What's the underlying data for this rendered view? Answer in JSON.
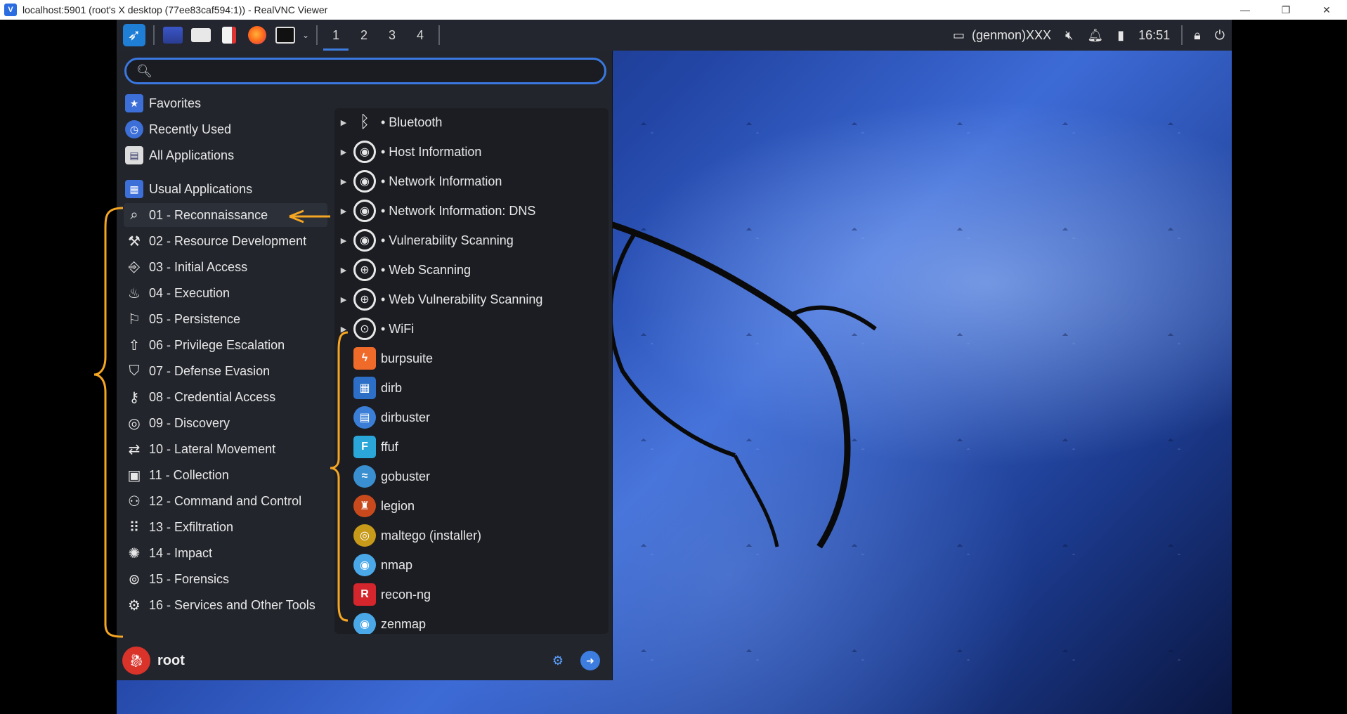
{
  "window": {
    "title": "localhost:5901 (root's X desktop (77ee83caf594:1)) - RealVNC Viewer",
    "minimize": "—",
    "maximize": "❐",
    "close": "✕"
  },
  "panel": {
    "workspaces": [
      "1",
      "2",
      "3",
      "4"
    ],
    "active_workspace": "1",
    "genmon": "(genmon)XXX",
    "clock": "16:51"
  },
  "menu": {
    "search_value": "",
    "categories": [
      {
        "label": "Favorites",
        "icon": "star-folder-icon"
      },
      {
        "label": "Recently Used",
        "icon": "clock-icon"
      },
      {
        "label": "All Applications",
        "icon": "apps-folder-icon"
      },
      {
        "label": "Usual Applications",
        "icon": "grid-icon"
      },
      {
        "label": "01 - Reconnaissance",
        "icon": "magnifier-icon"
      },
      {
        "label": "02 - Resource Development",
        "icon": "hammer-icon"
      },
      {
        "label": "03 - Initial Access",
        "icon": "door-icon"
      },
      {
        "label": "04 - Execution",
        "icon": "fire-icon"
      },
      {
        "label": "05 - Persistence",
        "icon": "runner-icon"
      },
      {
        "label": "06 - Privilege Escalation",
        "icon": "arrow-up-icon"
      },
      {
        "label": "07 - Defense Evasion",
        "icon": "shield-icon"
      },
      {
        "label": "08 - Credential Access",
        "icon": "key-icon"
      },
      {
        "label": "09 - Discovery",
        "icon": "radar-icon"
      },
      {
        "label": "10 - Lateral Movement",
        "icon": "swap-icon"
      },
      {
        "label": "11 - Collection",
        "icon": "archive-icon"
      },
      {
        "label": "12 - Command and Control",
        "icon": "gamepad-icon"
      },
      {
        "label": "13 - Exfiltration",
        "icon": "grid-dots-icon"
      },
      {
        "label": "14 - Impact",
        "icon": "blast-icon"
      },
      {
        "label": "15 - Forensics",
        "icon": "fingerprint-icon"
      },
      {
        "label": "16 - Services and Other Tools",
        "icon": "tools-icon"
      }
    ],
    "selected_category": "01 - Reconnaissance",
    "apps": [
      {
        "label": "• Bluetooth",
        "submenu": true,
        "icon": "bluetooth-icon"
      },
      {
        "label": "• Host Information",
        "submenu": true,
        "icon": "magnifier-icon"
      },
      {
        "label": "• Network Information",
        "submenu": true,
        "icon": "magnifier-icon"
      },
      {
        "label": "• Network Information: DNS",
        "submenu": true,
        "icon": "magnifier-icon"
      },
      {
        "label": "• Vulnerability Scanning",
        "submenu": true,
        "icon": "magnifier-icon"
      },
      {
        "label": "• Web Scanning",
        "submenu": true,
        "icon": "globe-icon"
      },
      {
        "label": "• Web Vulnerability Scanning",
        "submenu": true,
        "icon": "globe-icon"
      },
      {
        "label": "• WiFi",
        "submenu": true,
        "icon": "wifi-icon"
      },
      {
        "label": "burpsuite",
        "submenu": false,
        "icon": "burpsuite-icon"
      },
      {
        "label": "dirb",
        "submenu": false,
        "icon": "dirb-icon"
      },
      {
        "label": "dirbuster",
        "submenu": false,
        "icon": "dirbuster-icon"
      },
      {
        "label": "ffuf",
        "submenu": false,
        "icon": "ffuf-icon"
      },
      {
        "label": "gobuster",
        "submenu": false,
        "icon": "gobuster-icon"
      },
      {
        "label": "legion",
        "submenu": false,
        "icon": "legion-icon"
      },
      {
        "label": "maltego (installer)",
        "submenu": false,
        "icon": "maltego-icon"
      },
      {
        "label": "nmap",
        "submenu": false,
        "icon": "nmap-icon"
      },
      {
        "label": "recon-ng",
        "submenu": false,
        "icon": "recon-ng-icon"
      },
      {
        "label": "zenmap",
        "submenu": false,
        "icon": "zenmap-icon"
      }
    ],
    "user": "root"
  },
  "colors": {
    "accent": "#3a78e0",
    "annotation": "#f5a623",
    "panel_bg": "#23262e",
    "menu_bg": "#22252c"
  }
}
